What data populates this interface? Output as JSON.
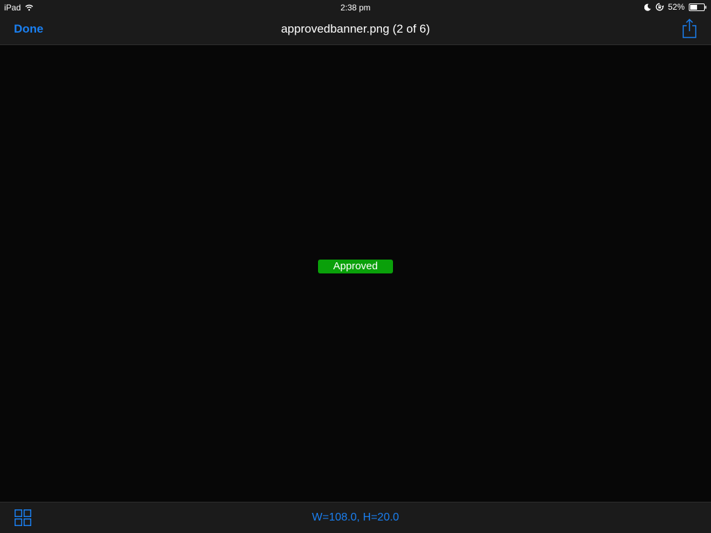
{
  "status_bar": {
    "device": "iPad",
    "time": "2:38 pm",
    "battery_percent": "52%",
    "battery_level": 0.52,
    "icons": [
      "wifi-icon",
      "moon-icon",
      "rotation-lock-icon",
      "battery-icon"
    ]
  },
  "nav_bar": {
    "done_label": "Done",
    "title": "approvedbanner.png (2 of 6)",
    "share_icon": "share-icon"
  },
  "content": {
    "banner_text": "Approved",
    "banner_color": "#0aa00a"
  },
  "toolbar": {
    "grid_icon": "grid-icon",
    "dimensions": "W=108.0, H=20.0"
  },
  "colors": {
    "accent": "#1a7ff0",
    "background": "#070707",
    "bar_background": "#1b1b1b"
  }
}
